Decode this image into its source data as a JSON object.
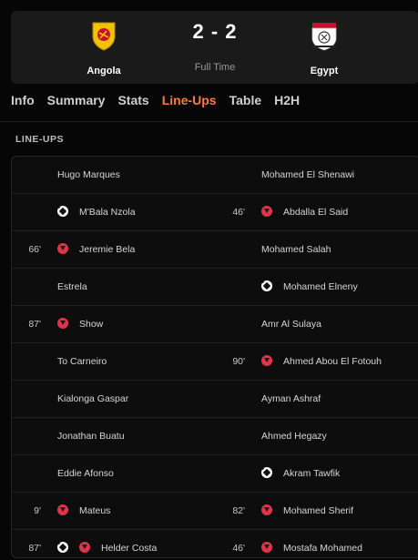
{
  "match": {
    "home_team": "Angola",
    "away_team": "Egypt",
    "score": "2 - 2",
    "status": "Full Time"
  },
  "tabs": [
    {
      "label": "Info"
    },
    {
      "label": "Summary"
    },
    {
      "label": "Stats"
    },
    {
      "label": "Line-Ups"
    },
    {
      "label": "Table"
    },
    {
      "label": "H2H"
    }
  ],
  "active_tab": "Line-Ups",
  "section_title": "LINE-UPS",
  "colors": {
    "accent": "#ff7a3d",
    "sub_out": "#e0344b",
    "own_goal_mark": "#3fbf55"
  },
  "lineups": [
    {
      "home": {
        "minute": "",
        "icons": [],
        "name": "Hugo Marques"
      },
      "away": {
        "minute": "",
        "icons": [],
        "name": "Mohamed El Shenawi"
      }
    },
    {
      "home": {
        "minute": "",
        "icons": [
          "own-goal-icon"
        ],
        "name": "M'Bala Nzola"
      },
      "away": {
        "minute": "46'",
        "icons": [
          "sub-out-icon"
        ],
        "name": "Abdalla El Said"
      }
    },
    {
      "home": {
        "minute": "66'",
        "icons": [
          "sub-out-icon"
        ],
        "name": "Jeremie Bela"
      },
      "away": {
        "minute": "",
        "icons": [],
        "name": "Mohamed Salah"
      }
    },
    {
      "home": {
        "minute": "",
        "icons": [],
        "name": "Estrela"
      },
      "away": {
        "minute": "",
        "icons": [
          "goal-icon"
        ],
        "name": "Mohamed Elneny"
      }
    },
    {
      "home": {
        "minute": "87'",
        "icons": [
          "sub-out-icon"
        ],
        "name": "Show"
      },
      "away": {
        "minute": "",
        "icons": [],
        "name": "Amr Al Sulaya"
      }
    },
    {
      "home": {
        "minute": "",
        "icons": [],
        "name": "To Carneiro"
      },
      "away": {
        "minute": "90'",
        "icons": [
          "sub-out-icon"
        ],
        "name": "Ahmed Abou El Fotouh"
      }
    },
    {
      "home": {
        "minute": "",
        "icons": [],
        "name": "Kialonga Gaspar"
      },
      "away": {
        "minute": "",
        "icons": [],
        "name": "Ayman Ashraf"
      }
    },
    {
      "home": {
        "minute": "",
        "icons": [],
        "name": "Jonathan Buatu"
      },
      "away": {
        "minute": "",
        "icons": [],
        "name": "Ahmed Hegazy"
      }
    },
    {
      "home": {
        "minute": "",
        "icons": [],
        "name": "Eddie Afonso"
      },
      "away": {
        "minute": "",
        "icons": [
          "goal-icon"
        ],
        "name": "Akram Tawfik"
      }
    },
    {
      "home": {
        "minute": "9'",
        "icons": [
          "sub-out-icon"
        ],
        "name": "Mateus"
      },
      "away": {
        "minute": "82'",
        "icons": [
          "sub-out-icon"
        ],
        "name": "Mohamed Sherif"
      }
    },
    {
      "home": {
        "minute": "87'",
        "icons": [
          "goal-icon",
          "sub-out-icon"
        ],
        "name": "Helder Costa"
      },
      "away": {
        "minute": "46'",
        "icons": [
          "sub-out-icon"
        ],
        "name": "Mostafa Mohamed"
      }
    }
  ]
}
